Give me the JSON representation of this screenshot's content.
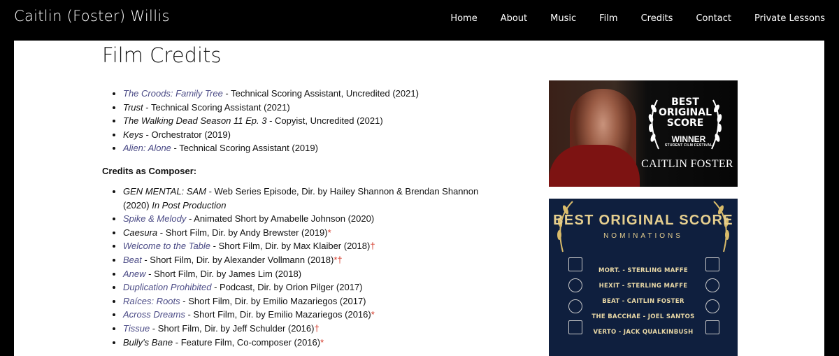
{
  "site": {
    "brand": "Caitlin (Foster) Willis",
    "nav": [
      "Home",
      "About",
      "Music",
      "Film",
      "Credits",
      "Contact",
      "Private Lessons"
    ]
  },
  "page": {
    "title": "Film Credits",
    "credits_list": [
      {
        "title": "The Croods: Family Tree",
        "linked": true,
        "detail": " - Technical Scoring Assistant, Uncredited (2021)",
        "mark": ""
      },
      {
        "title": "Trust",
        "linked": false,
        "detail": " - Technical Scoring Assistant (2021)",
        "mark": ""
      },
      {
        "title": "The Walking Dead Season 11 Ep. 3",
        "linked": false,
        "detail": " - Copyist, Uncredited (2021)",
        "mark": ""
      },
      {
        "title": "Keys",
        "linked": false,
        "detail": " - Orchestrator (2019)",
        "mark": ""
      },
      {
        "title": "Alien: Alone",
        "linked": true,
        "detail": " - Technical Scoring Assistant (2019)",
        "mark": ""
      }
    ],
    "composer_heading": "Credits as Composer:",
    "composer_list": [
      {
        "title": "GEN MENTAL: SAM",
        "linked": false,
        "detail": " - Web Series Episode, Dir. by Hailey Shannon & Brendan Shannon (2020) ",
        "extra": "In Post Production",
        "mark": ""
      },
      {
        "title": "Spike & Melody",
        "linked": true,
        "detail": " - Animated Short by Amabelle Johnson (2020)",
        "extra": "",
        "mark": ""
      },
      {
        "title": "Caesura",
        "linked": false,
        "detail": " - Short Film, Dir. by Andy Brewster (2019)",
        "extra": "",
        "mark": "*"
      },
      {
        "title": "Welcome to the Table",
        "linked": true,
        "detail": " - Short Film, Dir. by Max Klaiber (2018)",
        "extra": "",
        "mark": "†"
      },
      {
        "title": "Beat",
        "linked": true,
        "detail": " - Short Film, Dir. by Alexander Vollmann (2018)",
        "extra": "",
        "mark": "*†"
      },
      {
        "title": "Anew",
        "linked": true,
        "detail": " - Short Film, Dir. by James Lim (2018)",
        "extra": "",
        "mark": ""
      },
      {
        "title": "Duplication Prohibited",
        "linked": true,
        "detail": " - Podcast, Dir. by Orion Pilger (2017)",
        "extra": "",
        "mark": ""
      },
      {
        "title": "Raíces: Roots",
        "linked": true,
        "detail": " - Short Film, Dir. by Emilio Mazariegos (2017)",
        "extra": "",
        "mark": ""
      },
      {
        "title": "Across Dreams",
        "linked": true,
        "detail": " - Short Film, Dir. by Emilio Mazariegos (2016)",
        "extra": "",
        "mark": "*"
      },
      {
        "title": "Tissue",
        "linked": true,
        "detail": " - Short Film, Dir. by Jeff Schulder (2016)",
        "extra": "",
        "mark": "†"
      },
      {
        "title": "Bully's Bane",
        "linked": false,
        "detail": " - Feature Film, Co-composer (2016)",
        "extra": "",
        "mark": "*"
      }
    ]
  },
  "award_image": {
    "best": [
      "BEST",
      "ORIGINAL",
      "SCORE"
    ],
    "winner": "WINNER",
    "festival": "STUDENT FILM FESTIVAL",
    "name": "CAITLIN FOSTER"
  },
  "nominations_image": {
    "heading": "BEST ORIGINAL SCORE",
    "subheading": "NOMINATIONS",
    "entries": [
      "MORT. - STERLING MAFFE",
      "HEXIT - STERLING MAFFE",
      "BEAT - CAITLIN FOSTER",
      "THE BACCHAE - JOEL SANTOS",
      "VERTO - JACK QUALKINBUSH"
    ]
  },
  "colors": {
    "link": "#4b4b86",
    "mark": "#d43b2b",
    "gold": "#e6cf8f",
    "navy": "#0f1f3e"
  }
}
